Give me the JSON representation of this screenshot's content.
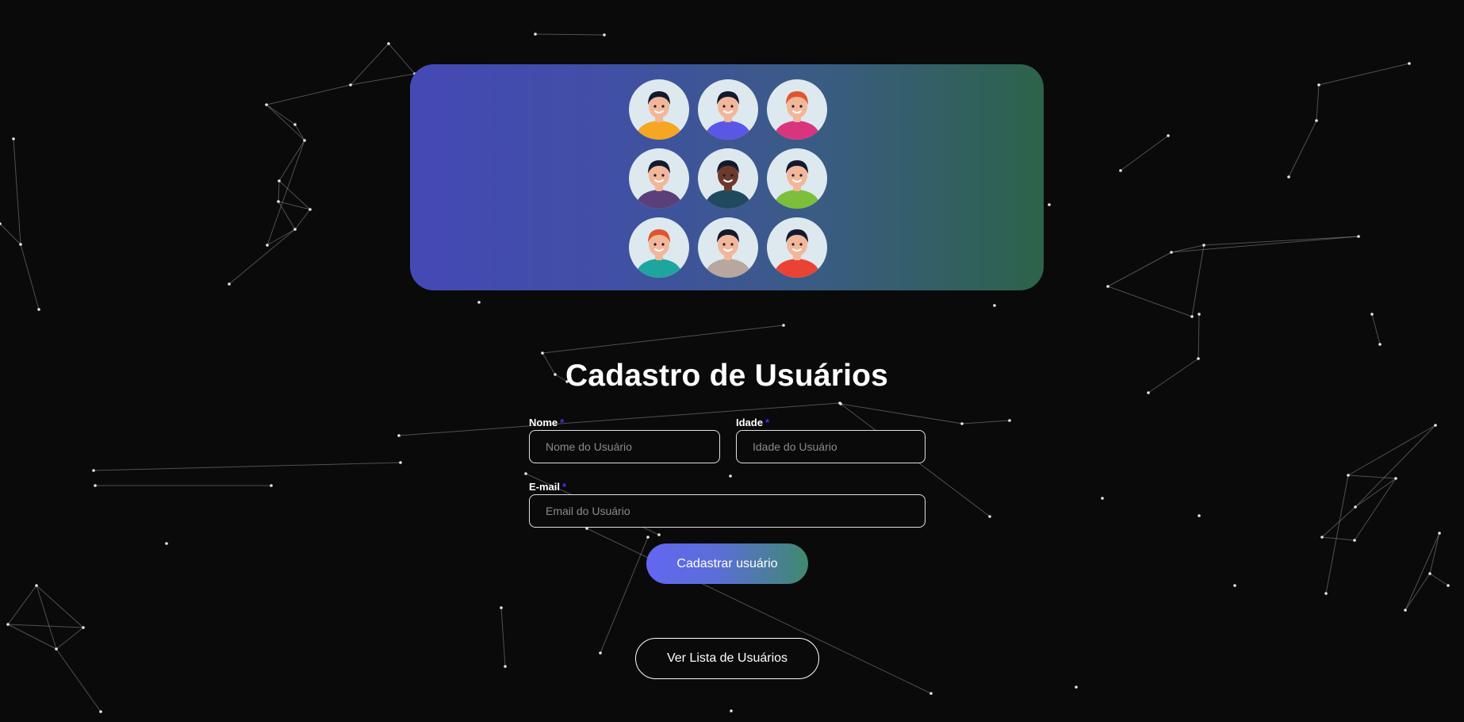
{
  "banner": {
    "avatars": [
      {
        "icon": "avatar-woman-dark-hair-orange-top",
        "skin": "#f2b79a",
        "hair": "#141a2e",
        "shirt": "#f5a623"
      },
      {
        "icon": "avatar-man-blue-shirt",
        "skin": "#f2b79a",
        "hair": "#141a2e",
        "shirt": "#5b57e6"
      },
      {
        "icon": "avatar-woman-red-hair-pink-top",
        "skin": "#f2b79a",
        "hair": "#e0552e",
        "shirt": "#d9347e"
      },
      {
        "icon": "avatar-woman-bun-purple-top",
        "skin": "#f2b79a",
        "hair": "#141a2e",
        "shirt": "#5b3f7a"
      },
      {
        "icon": "avatar-man-beard-dark-skin",
        "skin": "#6b3a2a",
        "hair": "#141a2e",
        "shirt": "#1f4a5e"
      },
      {
        "icon": "avatar-girl-pigtails-green-top",
        "skin": "#f2b79a",
        "hair": "#141a2e",
        "shirt": "#7bbf3a"
      },
      {
        "icon": "avatar-woman-red-hair-teal-top",
        "skin": "#f2b79a",
        "hair": "#e0552e",
        "shirt": "#1fa5a0"
      },
      {
        "icon": "avatar-man-spiky-hair-hoodie",
        "skin": "#f2b79a",
        "hair": "#141a2e",
        "shirt": "#b8a79e"
      },
      {
        "icon": "avatar-woman-ponytail-red-top",
        "skin": "#f2b79a",
        "hair": "#141a2e",
        "shirt": "#ea4335"
      }
    ]
  },
  "form": {
    "title": "Cadastro de Usuários",
    "name_label": "Nome",
    "name_placeholder": "Nome do Usuário",
    "age_label": "Idade",
    "age_placeholder": "Idade do Usuário",
    "email_label": "E-mail",
    "email_placeholder": "Email do Usuário",
    "required_mark": "*",
    "submit_label": "Cadastrar usuário"
  },
  "actions": {
    "list_label": "Ver Lista de Usuários"
  },
  "colors": {
    "background": "#0a0a0a",
    "banner_start": "#4449b5",
    "banner_end": "#2d6349",
    "required_mark": "#3b35ff",
    "submit_start": "#6366f1",
    "submit_end": "#3f8a6e"
  }
}
